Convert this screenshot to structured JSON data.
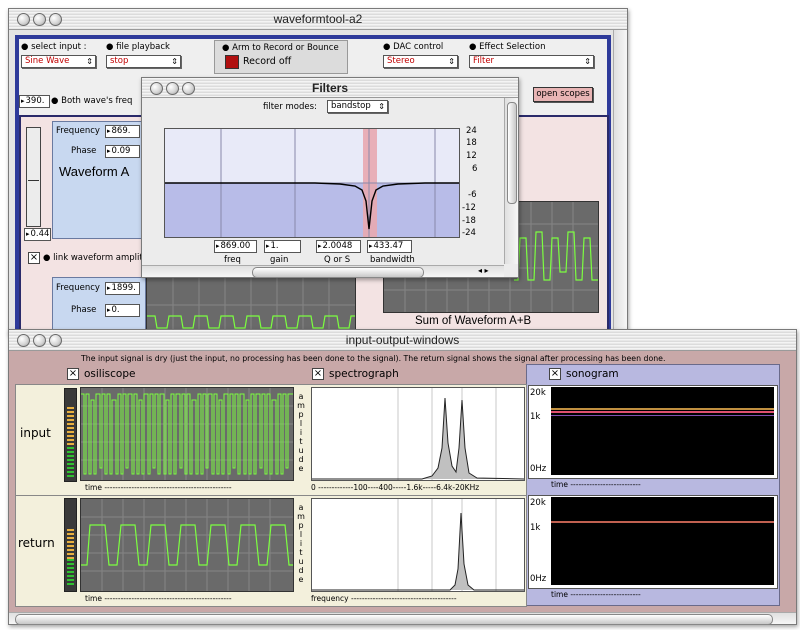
{
  "main_window": {
    "title": "waveformtool-a2",
    "select_input_label": "select input :",
    "select_input_value": "Sine Wave",
    "file_playback_label": "file playback",
    "file_playback_value": "stop",
    "arm_label": "Arm to Record or Bounce",
    "record_label": "Record off",
    "dac_label": "DAC control",
    "dac_value": "Stereo",
    "effect_label": "Effect Selection",
    "effect_value": "Filter",
    "both_freq_value": "390.",
    "both_freq_label": "Both wave's freq",
    "open_scopes": "open scopes",
    "waveform_a": {
      "title": "Waveform A",
      "frequency_label": "Frequency",
      "frequency_value": "869.",
      "phase_label": "Phase",
      "phase_value": "0.09",
      "slider_value": "0.44"
    },
    "link_label": "link waveform amplitu",
    "waveform_b": {
      "frequency_label": "Frequency",
      "frequency_value": "1899.",
      "phase_label": "Phase",
      "phase_value": "0."
    },
    "sum_label": "Sum of Waveform A+B"
  },
  "filters_window": {
    "title": "Filters",
    "mode_label": "filter modes:",
    "mode_value": "bandstop",
    "db_ticks": [
      "24",
      "18",
      "12",
      "6",
      "-6",
      "-12",
      "-18",
      "-24"
    ],
    "params": [
      {
        "value": "869.00",
        "label": "freq"
      },
      {
        "value": "1.",
        "label": "gain"
      },
      {
        "value": "2.0048",
        "label": "Q or S"
      },
      {
        "value": "433.47",
        "label": "bandwidth"
      }
    ]
  },
  "io_window": {
    "title": "input-output-windows",
    "description": "The input signal is dry (just the input, no processing has been done to the signal). The return signal shows the signal after processing has been done.",
    "osc_label": "osiliscope",
    "spec_label": "spectrograph",
    "sono_label": "sonogram",
    "input_label": "input",
    "return_label": "return",
    "amplitude_letters": [
      "a",
      "m",
      "p",
      "l",
      "i",
      "t",
      "u",
      "d",
      "e"
    ],
    "time_axis_input": "time -----------------------------------------------",
    "time_axis_return": "time -----------------------------------------------",
    "freq_axis_input": "0 -------------100----400-----1.6k-----6.4k-20KHz",
    "freq_axis_return": "frequency ---------------------------------------",
    "sono_time": "time --------------------------",
    "sono_ticks": [
      "20k",
      "1k",
      "0Hz"
    ]
  },
  "colors": {
    "main_bg": "#2e3a9a",
    "panel_pink": "#f3e3e3",
    "panel_blue": "#c8d8f0",
    "io_bg": "#c8a8a8",
    "sono_bg": "#b8b8e0",
    "scope_trace": "#7cff40",
    "filter_upper": "#e8eaf8",
    "filter_lower": "#b8bce8",
    "filter_band": "#e8a8b0"
  }
}
